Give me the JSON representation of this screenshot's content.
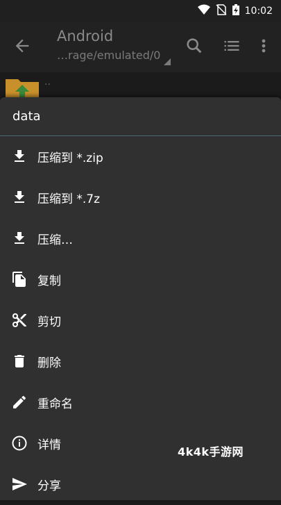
{
  "status": {
    "time": "10:02",
    "icons": [
      "wifi-icon",
      "no-sim-icon",
      "battery-charging-icon"
    ]
  },
  "appbar": {
    "title": "Android",
    "path": "…rage/emulated/0",
    "icons": [
      "back-arrow-icon",
      "search-icon",
      "list-view-icon",
      "more-vert-icon"
    ]
  },
  "behind": {
    "parent_label": ".."
  },
  "menu": {
    "header": "data",
    "items": [
      {
        "label": "压缩到 *.zip",
        "icon": "download-icon"
      },
      {
        "label": "压缩到 *.7z",
        "icon": "download-icon"
      },
      {
        "label": "压缩…",
        "icon": "download-icon"
      },
      {
        "label": "复制",
        "icon": "copy-icon"
      },
      {
        "label": "剪切",
        "icon": "scissors-icon"
      },
      {
        "label": "删除",
        "icon": "trash-icon"
      },
      {
        "label": "重命名",
        "icon": "pencil-icon"
      },
      {
        "label": "详情",
        "icon": "info-icon"
      },
      {
        "label": "分享",
        "icon": "share-icon"
      }
    ]
  },
  "watermark": "4k4k手游网",
  "colors": {
    "menu_bg": "#303030",
    "appbar_bg": "#222222",
    "divider": "#4a6a7a",
    "folder": "#c8902a",
    "folder_arrow": "#3a8a3a"
  }
}
